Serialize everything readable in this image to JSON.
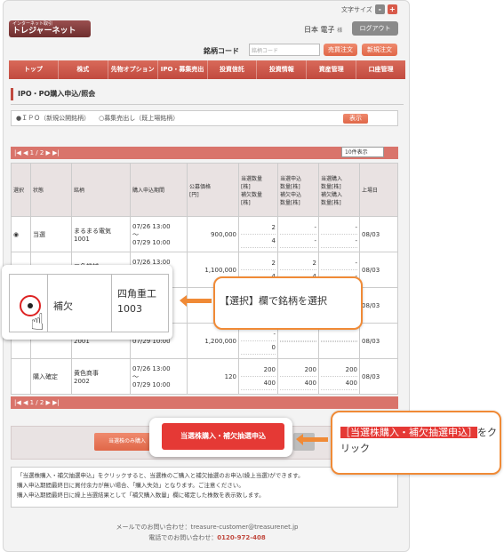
{
  "header": {
    "font_size_label": "文字サイズ",
    "font_minus": "-",
    "font_plus": "+",
    "logo_small": "インターネット取引",
    "logo_main": "トレジャーネット",
    "user_name": "日本 電子",
    "user_suffix": "様",
    "logout": "ログアウト"
  },
  "search": {
    "label": "銘柄コード",
    "placeholder": "銘柄コード",
    "sell_button": "売買注文",
    "new_order_button": "新規注文"
  },
  "nav": [
    "トップ",
    "株式",
    "先物オプション",
    "IPO・募集売出",
    "投資信託",
    "投資情報",
    "資産管理",
    "口座管理"
  ],
  "page_title": "IPO・PO購入申込/照会",
  "filter": {
    "option1": "●ＩＰＯ（新規公開銘柄）",
    "option2": "○募集売出し（既上場銘柄）",
    "show_button": "表示"
  },
  "pager": {
    "text": "|◀ ◀ 1 / 2 ▶ ▶|",
    "per_page": "10件表示"
  },
  "table": {
    "headers": [
      "選択",
      "状態",
      "銘柄",
      "購入申込期間",
      "公募価格\n[円]",
      "当選数量\n[株]\n補欠数量\n[株]",
      "当選申込\n数量[株]\n補欠申込\n数量[株]",
      "当選購入\n数量[株]\n補欠購入\n数量[株]",
      "上場日"
    ],
    "rows": [
      {
        "select": "◉",
        "status": "当選",
        "name": "まるまる電気",
        "code": "1001",
        "p1": "07/26 13:00",
        "p2": "〜",
        "p3": "07/29 10:00",
        "price": "900,000",
        "a1": "2",
        "a2": "4",
        "b1": "-",
        "b2": "-",
        "c1": "-",
        "c2": "-",
        "date": "08/03"
      },
      {
        "select": "",
        "status": "申込済",
        "name": "三角機械",
        "code": "1002",
        "p1": "07/26 13:00",
        "p2": "〜",
        "p3": "07/29 10:00",
        "price": "1,100,000",
        "a1": "2",
        "a2": "4",
        "b1": "2",
        "b2": "4",
        "c1": "-",
        "c2": "-",
        "date": "08/03"
      },
      {
        "select": "",
        "status": "",
        "name": "",
        "code": "",
        "p1": "",
        "p2": "",
        "p3": "",
        "price": "",
        "a1": "",
        "a2": "",
        "b1": "",
        "b2": "",
        "c1": "",
        "c2": "",
        "date": "08/03"
      },
      {
        "select": "",
        "status": "",
        "name": "",
        "code": "2001",
        "p1": "",
        "p2": "",
        "p3": "07/29 10:00",
        "price": "1,200,000",
        "a1": "-",
        "a2": "0",
        "b1": "",
        "b2": "",
        "c1": "",
        "c2": "",
        "date": "08/03"
      },
      {
        "select": "",
        "status": "購入確定",
        "name": "黄色商事",
        "code": "2002",
        "p1": "07/26 13:00",
        "p2": "〜",
        "p3": "07/29 10:00",
        "price": "120",
        "a1": "200",
        "a2": "400",
        "b1": "200",
        "b2": "400",
        "c1": "200",
        "c2": "400",
        "date": "08/03"
      }
    ]
  },
  "buttons": {
    "mine": "当選株のみ購入",
    "main": "当選株購入・補欠抽選申込"
  },
  "notes": [
    "「当選株購入・補欠抽選申込」をクリックすると、当選株のご購入と補欠抽選のお申込(繰上当選)ができます。",
    "購入申込期間最終日に買付余力が無い場合、「購入失効」となります。ご注意ください。",
    "購入申込期間最終日に繰上当選結果として「補欠購入数量」欄に確定した株数を表示致します。"
  ],
  "footer": {
    "mail_label": "メールでのお問い合わせ：",
    "mail": "treasure-customer@treasurenet.jp",
    "tel_label": "電話でのお問い合わせ：",
    "tel": "0120-972-408"
  },
  "zoom": {
    "label": "補欠",
    "name": "四角重工",
    "code": "1003"
  },
  "callout1": "【選択】欄で銘柄を選択",
  "callout2": {
    "highlight": "［当選株購入・補欠抽選申込］",
    "rest": "をクリック"
  },
  "colors": {
    "accent": "#c14a3f",
    "callout": "#f08a36",
    "highlight": "#e53935"
  }
}
